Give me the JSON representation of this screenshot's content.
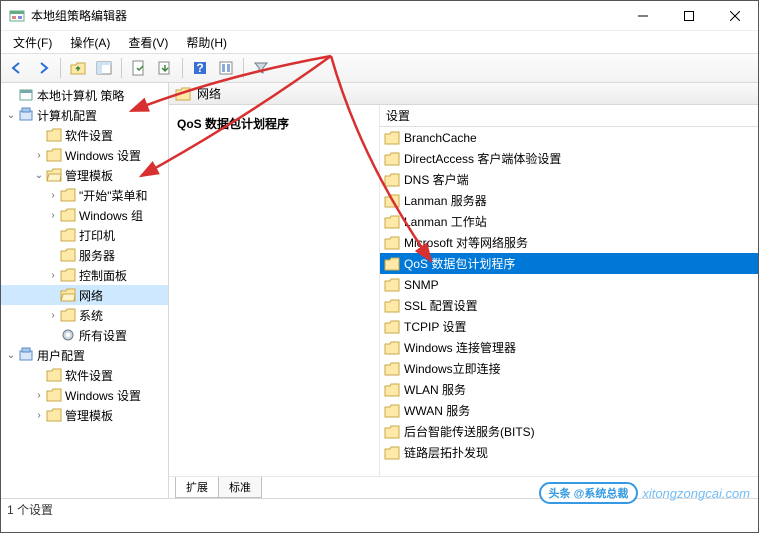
{
  "window": {
    "title": "本地组策略编辑器"
  },
  "menu": {
    "file": "文件(F)",
    "action": "操作(A)",
    "view": "查看(V)",
    "help": "帮助(H)"
  },
  "tree": {
    "root": "本地计算机 策略",
    "computer": "计算机配置",
    "computer_children": [
      {
        "label": "软件设置",
        "depth": 2,
        "exp": ""
      },
      {
        "label": "Windows 设置",
        "depth": 2,
        "exp": ">"
      },
      {
        "label": "管理模板",
        "depth": 2,
        "exp": "v",
        "open": true
      },
      {
        "label": "\"开始\"菜单和",
        "depth": 3,
        "exp": ">"
      },
      {
        "label": "Windows 组",
        "depth": 3,
        "exp": ">"
      },
      {
        "label": "打印机",
        "depth": 3,
        "exp": ""
      },
      {
        "label": "服务器",
        "depth": 3,
        "exp": ""
      },
      {
        "label": "控制面板",
        "depth": 3,
        "exp": ">"
      },
      {
        "label": "网络",
        "depth": 3,
        "exp": "",
        "open": true,
        "sel": true
      },
      {
        "label": "系统",
        "depth": 3,
        "exp": ">"
      },
      {
        "label": "所有设置",
        "depth": 3,
        "exp": "",
        "icon": "settings"
      }
    ],
    "user": "用户配置",
    "user_children": [
      {
        "label": "软件设置",
        "depth": 2,
        "exp": ""
      },
      {
        "label": "Windows 设置",
        "depth": 2,
        "exp": ">"
      },
      {
        "label": "管理模板",
        "depth": 2,
        "exp": ">"
      }
    ]
  },
  "breadcrumb": {
    "label": "网络"
  },
  "detail": {
    "header": "QoS 数据包计划程序"
  },
  "settings_col": "设置",
  "list": [
    {
      "label": "BranchCache"
    },
    {
      "label": "DirectAccess 客户端体验设置"
    },
    {
      "label": "DNS 客户端"
    },
    {
      "label": "Lanman 服务器"
    },
    {
      "label": "Lanman 工作站"
    },
    {
      "label": "Microsoft 对等网络服务"
    },
    {
      "label": "QoS 数据包计划程序",
      "sel": true
    },
    {
      "label": "SNMP"
    },
    {
      "label": "SSL 配置设置"
    },
    {
      "label": "TCPIP 设置"
    },
    {
      "label": "Windows 连接管理器"
    },
    {
      "label": "Windows立即连接"
    },
    {
      "label": "WLAN 服务"
    },
    {
      "label": "WWAN 服务"
    },
    {
      "label": "后台智能传送服务(BITS)"
    },
    {
      "label": "链路层拓扑发现"
    }
  ],
  "tabs": {
    "extended": "扩展",
    "standard": "标准"
  },
  "status": "1 个设置",
  "watermark": {
    "badge": "头条 @系统总裁",
    "url": "xitongzongcai.com"
  }
}
